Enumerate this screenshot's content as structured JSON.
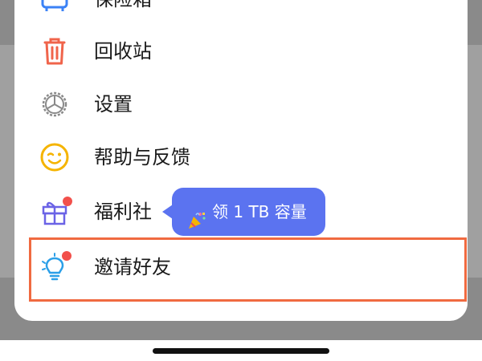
{
  "menu": {
    "items": [
      {
        "label": "保险箱",
        "icon": "safe-box-icon",
        "color": "#3b82f6"
      },
      {
        "label": "回收站",
        "icon": "trash-icon",
        "color": "#f0644b"
      },
      {
        "label": "设置",
        "icon": "gear-icon",
        "color": "#8a8a8a"
      },
      {
        "label": "帮助与反馈",
        "icon": "wink-face-icon",
        "color": "#f5b400"
      },
      {
        "label": "福利社",
        "icon": "gift-icon",
        "color": "#6b63e6",
        "badge": true
      },
      {
        "label": "邀请好友",
        "icon": "lightbulb-icon",
        "color": "#2b9fe8",
        "badge": true
      }
    ]
  },
  "tooltip": {
    "text": "领 1 TB 容量",
    "icon": "party-popper-icon",
    "color": "#5b73f0"
  },
  "highlight": {
    "target": "邀请好友",
    "color": "#f06a40"
  }
}
